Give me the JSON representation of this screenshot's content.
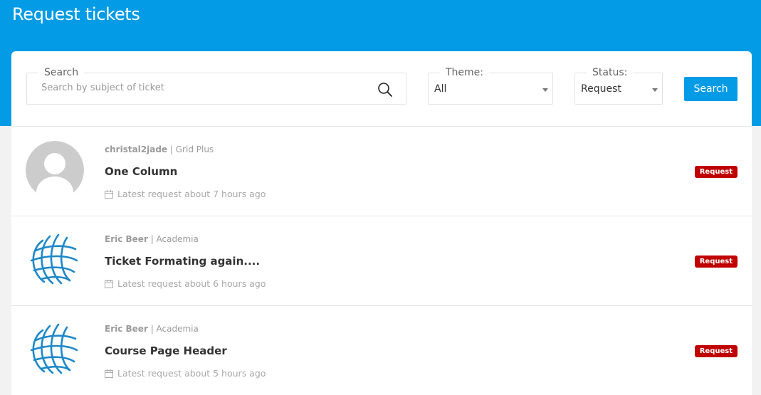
{
  "header": {
    "title": "Request tickets"
  },
  "filters": {
    "search": {
      "legend": "Search",
      "placeholder": "Search by subject of ticket",
      "value": ""
    },
    "theme": {
      "legend": "Theme:",
      "value": "All"
    },
    "status": {
      "legend": "Status:",
      "value": "Request"
    },
    "search_button": "Search"
  },
  "tickets": [
    {
      "author": "christal2jade",
      "separator": " | ",
      "theme": "Grid Plus",
      "subject": "One Column",
      "latest": "Latest request about 7 hours ago",
      "status": "Request",
      "avatar": "default-user-avatar"
    },
    {
      "author": "Eric Beer",
      "separator": " | ",
      "theme": "Academia",
      "subject": "Ticket Formating again....",
      "latest": "Latest request about 6 hours ago",
      "status": "Request",
      "avatar": "globe-logo"
    },
    {
      "author": "Eric Beer",
      "separator": " | ",
      "theme": "Academia",
      "subject": "Course Page Header",
      "latest": "Latest request about 5 hours ago",
      "status": "Request",
      "avatar": "globe-logo"
    }
  ],
  "colors": {
    "primary": "#039be5",
    "badge": "#c00000",
    "background": "#f2f2f2"
  }
}
